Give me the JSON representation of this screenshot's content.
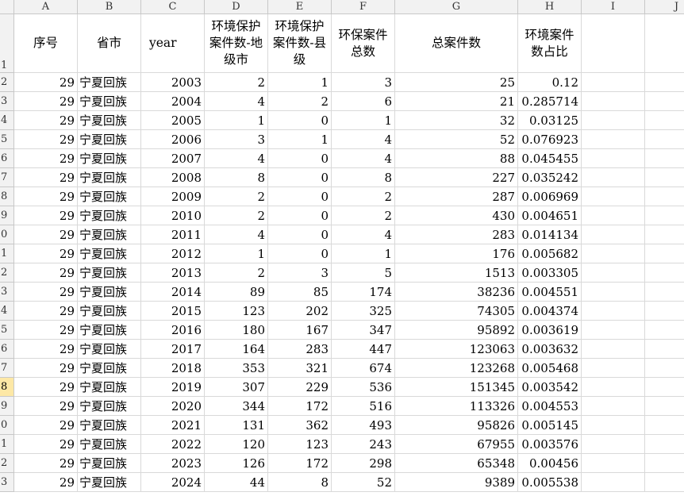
{
  "column_letters": [
    "A",
    "B",
    "C",
    "D",
    "E",
    "F",
    "G",
    "H",
    "I",
    "J"
  ],
  "row_numbers": [
    "1",
    "2",
    "3",
    "4",
    "5",
    "6",
    "7",
    "8",
    "9",
    "0",
    "1",
    "2",
    "3",
    "4",
    "5",
    "6",
    "7",
    "8",
    "9",
    "0",
    "1",
    "2",
    "3"
  ],
  "selected_row_index": 17,
  "header_row": [
    "序号",
    "省市",
    "year",
    "环境保护案件数-地级市",
    "环境保护案件数-县级",
    "环保案件总数",
    "总案件数",
    "环境案件数占比"
  ],
  "rows": [
    [
      "29",
      "宁夏回族",
      "2003",
      "2",
      "1",
      "3",
      "25",
      "0.12"
    ],
    [
      "29",
      "宁夏回族",
      "2004",
      "4",
      "2",
      "6",
      "21",
      "0.285714"
    ],
    [
      "29",
      "宁夏回族",
      "2005",
      "1",
      "0",
      "1",
      "32",
      "0.03125"
    ],
    [
      "29",
      "宁夏回族",
      "2006",
      "3",
      "1",
      "4",
      "52",
      "0.076923"
    ],
    [
      "29",
      "宁夏回族",
      "2007",
      "4",
      "0",
      "4",
      "88",
      "0.045455"
    ],
    [
      "29",
      "宁夏回族",
      "2008",
      "8",
      "0",
      "8",
      "227",
      "0.035242"
    ],
    [
      "29",
      "宁夏回族",
      "2009",
      "2",
      "0",
      "2",
      "287",
      "0.006969"
    ],
    [
      "29",
      "宁夏回族",
      "2010",
      "2",
      "0",
      "2",
      "430",
      "0.004651"
    ],
    [
      "29",
      "宁夏回族",
      "2011",
      "4",
      "0",
      "4",
      "283",
      "0.014134"
    ],
    [
      "29",
      "宁夏回族",
      "2012",
      "1",
      "0",
      "1",
      "176",
      "0.005682"
    ],
    [
      "29",
      "宁夏回族",
      "2013",
      "2",
      "3",
      "5",
      "1513",
      "0.003305"
    ],
    [
      "29",
      "宁夏回族",
      "2014",
      "89",
      "85",
      "174",
      "38236",
      "0.004551"
    ],
    [
      "29",
      "宁夏回族",
      "2015",
      "123",
      "202",
      "325",
      "74305",
      "0.004374"
    ],
    [
      "29",
      "宁夏回族",
      "2016",
      "180",
      "167",
      "347",
      "95892",
      "0.003619"
    ],
    [
      "29",
      "宁夏回族",
      "2017",
      "164",
      "283",
      "447",
      "123063",
      "0.003632"
    ],
    [
      "29",
      "宁夏回族",
      "2018",
      "353",
      "321",
      "674",
      "123268",
      "0.005468"
    ],
    [
      "29",
      "宁夏回族",
      "2019",
      "307",
      "229",
      "536",
      "151345",
      "0.003542"
    ],
    [
      "29",
      "宁夏回族",
      "2020",
      "344",
      "172",
      "516",
      "113326",
      "0.004553"
    ],
    [
      "29",
      "宁夏回族",
      "2021",
      "131",
      "362",
      "493",
      "95826",
      "0.005145"
    ],
    [
      "29",
      "宁夏回族",
      "2022",
      "120",
      "123",
      "243",
      "67955",
      "0.003576"
    ],
    [
      "29",
      "宁夏回族",
      "2023",
      "126",
      "172",
      "298",
      "65348",
      "0.00456"
    ],
    [
      "29",
      "宁夏回族",
      "2024",
      "44",
      "8",
      "52",
      "9389",
      "0.005538"
    ]
  ],
  "colors": {
    "header_bg": "#f2f2f2",
    "grid": "#d9d9d9",
    "selected_row_header": "#fde8a6"
  }
}
